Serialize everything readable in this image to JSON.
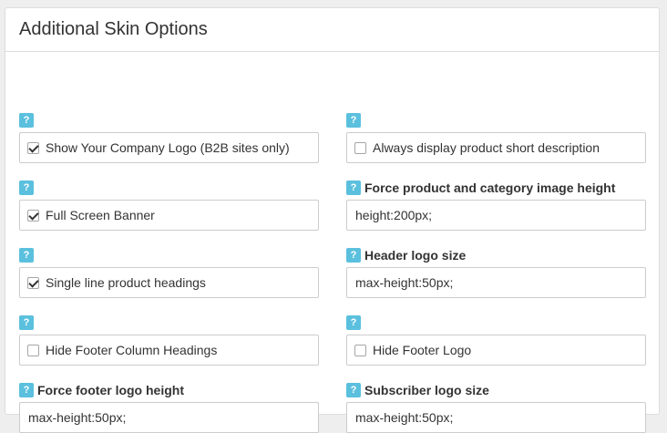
{
  "panel": {
    "title": "Additional Skin Options"
  },
  "help_icon": "?",
  "left": [
    {
      "type": "checkbox",
      "label": "",
      "checkbox_label": "Show Your Company Logo (B2B sites only)",
      "checked": true
    },
    {
      "type": "checkbox",
      "label": "",
      "checkbox_label": "Full Screen Banner",
      "checked": true
    },
    {
      "type": "checkbox",
      "label": "",
      "checkbox_label": "Single line product headings",
      "checked": true
    },
    {
      "type": "checkbox",
      "label": "",
      "checkbox_label": "Hide Footer Column Headings",
      "checked": false
    },
    {
      "type": "input",
      "label": "Force footer logo height",
      "value": "max-height:50px;"
    }
  ],
  "right": [
    {
      "type": "checkbox",
      "label": "",
      "checkbox_label": "Always display product short description",
      "checked": false
    },
    {
      "type": "input",
      "label": "Force product and category image height",
      "value": "height:200px;"
    },
    {
      "type": "input",
      "label": "Header logo size",
      "value": "max-height:50px;"
    },
    {
      "type": "checkbox",
      "label": "",
      "checkbox_label": "Hide Footer Logo",
      "checked": false
    },
    {
      "type": "input",
      "label": "Subscriber logo size",
      "value": "max-height:50px;"
    }
  ],
  "colors": {
    "help_icon": "#5bc0de",
    "border": "#cccccc",
    "background": "#eeeeee"
  }
}
